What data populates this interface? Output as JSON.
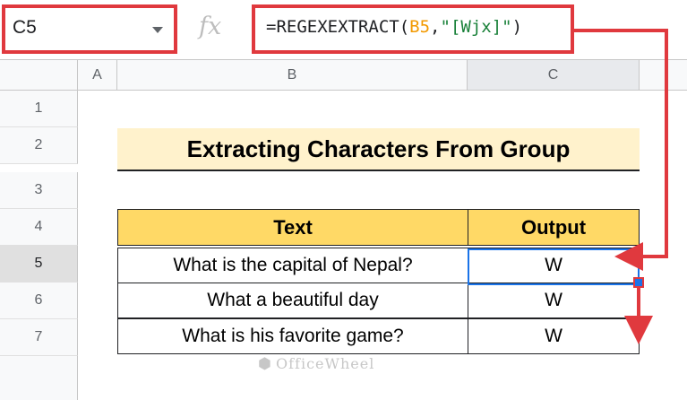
{
  "formula_bar": {
    "name_box": "C5",
    "fx_label": "fx",
    "formula_prefix": "=REGEXEXTRACT(",
    "formula_ref": "B5",
    "formula_sep": ",",
    "formula_string": "\"[Wjx]\"",
    "formula_suffix": ")"
  },
  "columns": [
    "A",
    "B",
    "C"
  ],
  "rows": [
    "1",
    "2",
    "3",
    "4",
    "5",
    "6",
    "7"
  ],
  "title": "Extracting Characters From Group",
  "table": {
    "headers": [
      "Text",
      "Output"
    ],
    "rows": [
      {
        "text": "What is the capital of Nepal?",
        "output": "W"
      },
      {
        "text": "What a beautiful day",
        "output": "W"
      },
      {
        "text": "What is his favorite game?",
        "output": "W"
      }
    ]
  },
  "watermark": "OfficeWheel",
  "colors": {
    "highlight_border": "#e0393e",
    "selection": "#1a73e8",
    "title_fill": "#fff2cc",
    "header_fill": "#ffd966"
  }
}
